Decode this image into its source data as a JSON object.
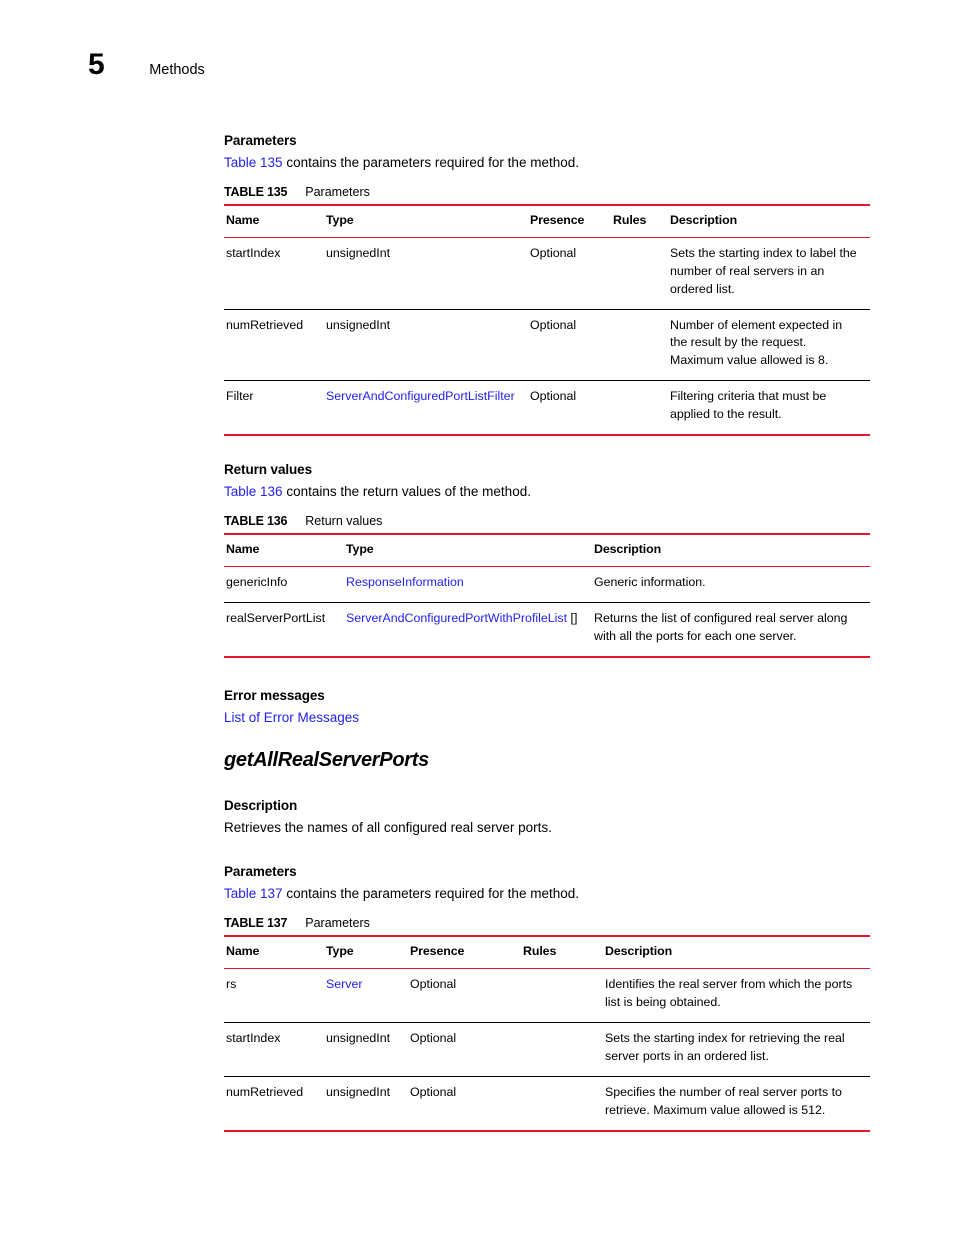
{
  "page": {
    "chapter_number": "5",
    "chapter_title": "Methods"
  },
  "sections": {
    "parameters_1": {
      "heading": "Parameters",
      "intro_link": "Table 135",
      "intro_rest": " contains the parameters required for the method."
    },
    "return_values": {
      "heading": "Return values",
      "intro_link": "Table 136",
      "intro_rest": " contains the return values of the method."
    },
    "error_messages": {
      "heading": "Error messages",
      "link": "List of Error Messages"
    },
    "method": {
      "name": "getAllRealServerPorts",
      "description_heading": "Description",
      "description_text": "Retrieves the names of all configured real server ports."
    },
    "parameters_2": {
      "heading": "Parameters",
      "intro_link": "Table 137",
      "intro_rest": " contains the parameters required for the method."
    }
  },
  "tables": {
    "table135": {
      "label": "TABLE 135",
      "title": "Parameters",
      "columns": [
        "Name",
        "Type",
        "Presence",
        "Rules",
        "Description"
      ],
      "rows": [
        {
          "name": "startIndex",
          "type": "unsignedInt",
          "type_is_link": false,
          "type_suffix": "",
          "presence": "Optional",
          "rules": "",
          "description": "Sets the starting index to label the number of real servers in an ordered list."
        },
        {
          "name": "numRetrieved",
          "type": "unsignedInt",
          "type_is_link": false,
          "type_suffix": "",
          "presence": "Optional",
          "rules": "",
          "description": "Number of element expected in the result by the request. Maximum value allowed is 8."
        },
        {
          "name": "Filter",
          "type": "ServerAndConfiguredPortListFilter",
          "type_is_link": true,
          "type_suffix": "",
          "presence": "Optional",
          "rules": "",
          "description": "Filtering criteria that must be applied to the result."
        }
      ]
    },
    "table136": {
      "label": "TABLE 136",
      "title": "Return values",
      "columns": [
        "Name",
        "Type",
        "Description"
      ],
      "rows": [
        {
          "name": "genericInfo",
          "type": "ResponseInformation",
          "type_is_link": true,
          "type_suffix": "",
          "description": "Generic information."
        },
        {
          "name": "realServerPortList",
          "type": "ServerAndConfiguredPortWithProfileList",
          "type_is_link": true,
          "type_suffix": " []",
          "description": "Returns the list of configured real server along with all the ports for each one server."
        }
      ]
    },
    "table137": {
      "label": "TABLE 137",
      "title": "Parameters",
      "columns": [
        "Name",
        "Type",
        "Presence",
        "Rules",
        "Description"
      ],
      "rows": [
        {
          "name": "rs",
          "type": "Server",
          "type_is_link": true,
          "type_suffix": "",
          "presence": "Optional",
          "rules": "",
          "description": "Identifies the real server from which the ports list is being obtained."
        },
        {
          "name": "startIndex",
          "type": "unsignedInt",
          "type_is_link": false,
          "type_suffix": "",
          "presence": "Optional",
          "rules": "",
          "description": "Sets the starting index for retrieving the real server ports in an ordered list."
        },
        {
          "name": "numRetrieved",
          "type": "unsignedInt",
          "type_is_link": false,
          "type_suffix": "",
          "presence": "Optional",
          "rules": "",
          "description": "Specifies the number of real server ports to retrieve. Maximum value allowed is 512."
        }
      ]
    }
  },
  "colors": {
    "link": "#2222EE",
    "rule_red": "#E4162B",
    "rule_black": "#000000",
    "text": "#000000"
  }
}
